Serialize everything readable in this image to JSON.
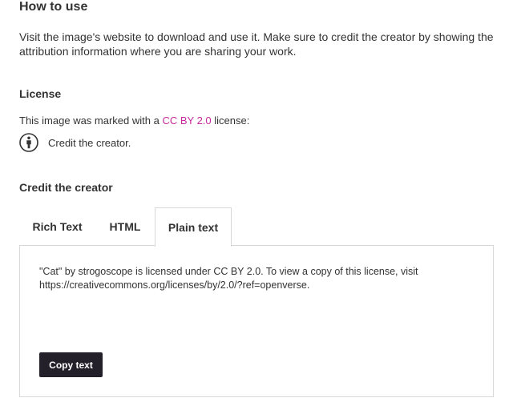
{
  "how_to_use": {
    "title": "How to use",
    "description": "Visit the image's website to download and use it. Make sure to credit the creator by showing the attribution information where you are sharing your work."
  },
  "license": {
    "title": "License",
    "prefix": "This image was marked with a",
    "link_text": "CC BY 2.0",
    "suffix": "license:",
    "credit_icon": "cc-by-person-icon",
    "credit_text": "Credit the creator."
  },
  "credit": {
    "title": "Credit the creator",
    "tabs": [
      "Rich Text",
      "HTML",
      "Plain text"
    ],
    "active_tab": "Plain text",
    "attribution_line1": "\"Cat\" by strogoscope is licensed under CC BY 2.0. To view a copy of this license, visit",
    "attribution_line2": "https://creativecommons.org/licenses/by/2.0/?ref=openverse.",
    "copy_button": "Copy text"
  },
  "colors": {
    "link": "#c52b9b",
    "button_bg": "#23202a",
    "border": "#d8d8d8",
    "text": "#333333"
  }
}
